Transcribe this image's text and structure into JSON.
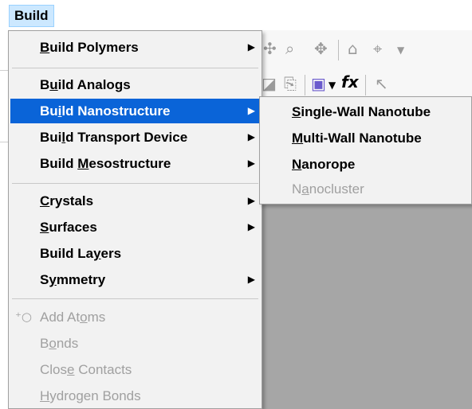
{
  "menubar": {
    "build_label": "Build"
  },
  "menu": {
    "items": [
      {
        "pre": "",
        "u": "B",
        "post": "uild Polymers",
        "submenu": true,
        "state": "normal"
      },
      {
        "pre": "B",
        "u": "u",
        "post": "ild Analogs",
        "submenu": false,
        "state": "normal"
      },
      {
        "pre": "Bu",
        "u": "i",
        "post": "ld Nanostructure",
        "submenu": true,
        "state": "highlighted"
      },
      {
        "pre": "Bui",
        "u": "l",
        "post": "d Transport Device",
        "submenu": true,
        "state": "normal"
      },
      {
        "pre": "Build ",
        "u": "M",
        "post": "esostructure",
        "submenu": true,
        "state": "normal"
      },
      {
        "pre": "",
        "u": "C",
        "post": "rystals",
        "submenu": true,
        "state": "normal"
      },
      {
        "pre": "",
        "u": "S",
        "post": "urfaces",
        "submenu": true,
        "state": "normal"
      },
      {
        "pre": "Build La",
        "u": "y",
        "post": "ers",
        "submenu": false,
        "state": "normal"
      },
      {
        "pre": "S",
        "u": "y",
        "post": "mmetry",
        "submenu": true,
        "state": "normal"
      },
      {
        "pre": "Add At",
        "u": "o",
        "post": "ms",
        "submenu": false,
        "state": "disabled",
        "icon": "add-atom-icon"
      },
      {
        "pre": "B",
        "u": "o",
        "post": "nds",
        "submenu": false,
        "state": "disabled"
      },
      {
        "pre": "Clos",
        "u": "e",
        "post": " Contacts",
        "submenu": false,
        "state": "disabled"
      },
      {
        "pre": "",
        "u": "H",
        "post": "ydrogen Bonds",
        "submenu": false,
        "state": "disabled"
      }
    ],
    "arrow_glyph": "▶",
    "add_icon_glyph": "⁺○"
  },
  "submenu": {
    "items": [
      {
        "pre": "",
        "u": "S",
        "post": "ingle-Wall Nanotube",
        "state": "normal"
      },
      {
        "pre": "",
        "u": "M",
        "post": "ulti-Wall Nanotube",
        "state": "normal"
      },
      {
        "pre": "",
        "u": "N",
        "post": "anorope",
        "state": "normal"
      },
      {
        "pre": "N",
        "u": "a",
        "post": "nocluster",
        "state": "disabled"
      }
    ]
  },
  "toolbar": {
    "icons": [
      "rotate-icon",
      "translate-icon",
      "zoom-icon",
      "pan-icon",
      "home-icon",
      "center-icon",
      "dropdown-icon"
    ]
  },
  "colors": {
    "highlight": "#0a64d8",
    "menu_bg": "#f2f2f2",
    "disabled_text": "#a0a0a0",
    "canvas": "#a6a6a6",
    "menubar_active": "#cce8ff"
  }
}
